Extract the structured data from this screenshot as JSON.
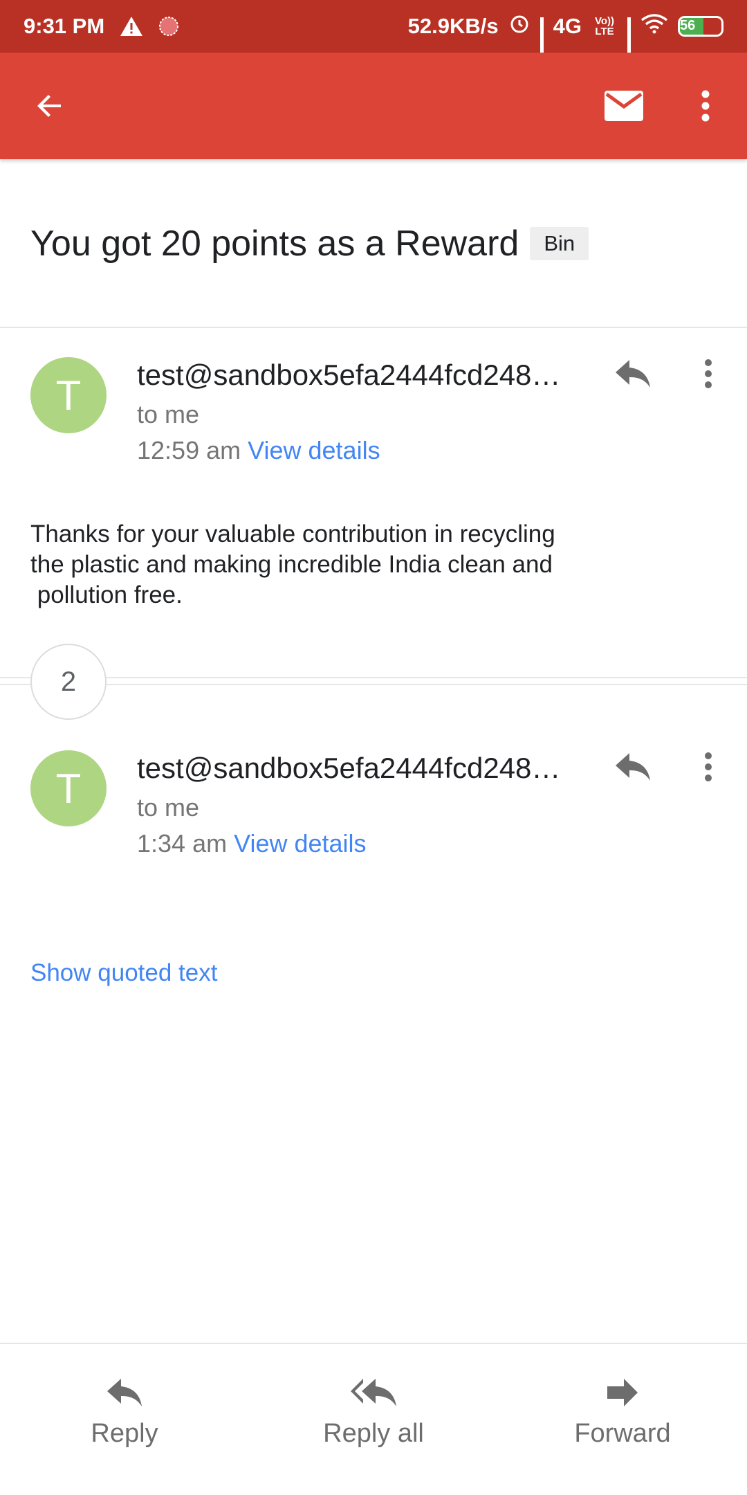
{
  "status_bar": {
    "time": "9:31 PM",
    "network_speed": "52.9KB/s",
    "network_type": "4G",
    "volte_label": "Vo)) LTE",
    "battery_level": "56",
    "battery_fraction": 0.56
  },
  "app_bar": {
    "back_icon": "arrow-back-icon",
    "mail_icon": "mail-icon",
    "more_icon": "more-vert-icon"
  },
  "subject": {
    "title": "You got 20 points as a Reward",
    "label": "Bin"
  },
  "messages": [
    {
      "avatar_initial": "T",
      "sender": "test@sandbox5efa2444fcd248…",
      "recipient": "to me",
      "time": "12:59 am",
      "view_details": "View details",
      "body_lines": [
        "Thanks for your valuable contribution in recycling",
        "the plastic and making incredible India clean and",
        " pollution free."
      ]
    },
    {
      "avatar_initial": "T",
      "sender": "test@sandbox5efa2444fcd248…",
      "recipient": "to me",
      "time": "1:34 am",
      "view_details": "View details",
      "show_quoted": "Show quoted text"
    }
  ],
  "collapsed_count": "2",
  "actions": {
    "reply": "Reply",
    "reply_all": "Reply all",
    "forward": "Forward"
  },
  "colors": {
    "status_bar": "#b83124",
    "app_bar": "#db4437",
    "avatar": "#aed581",
    "link": "#4285f4"
  }
}
